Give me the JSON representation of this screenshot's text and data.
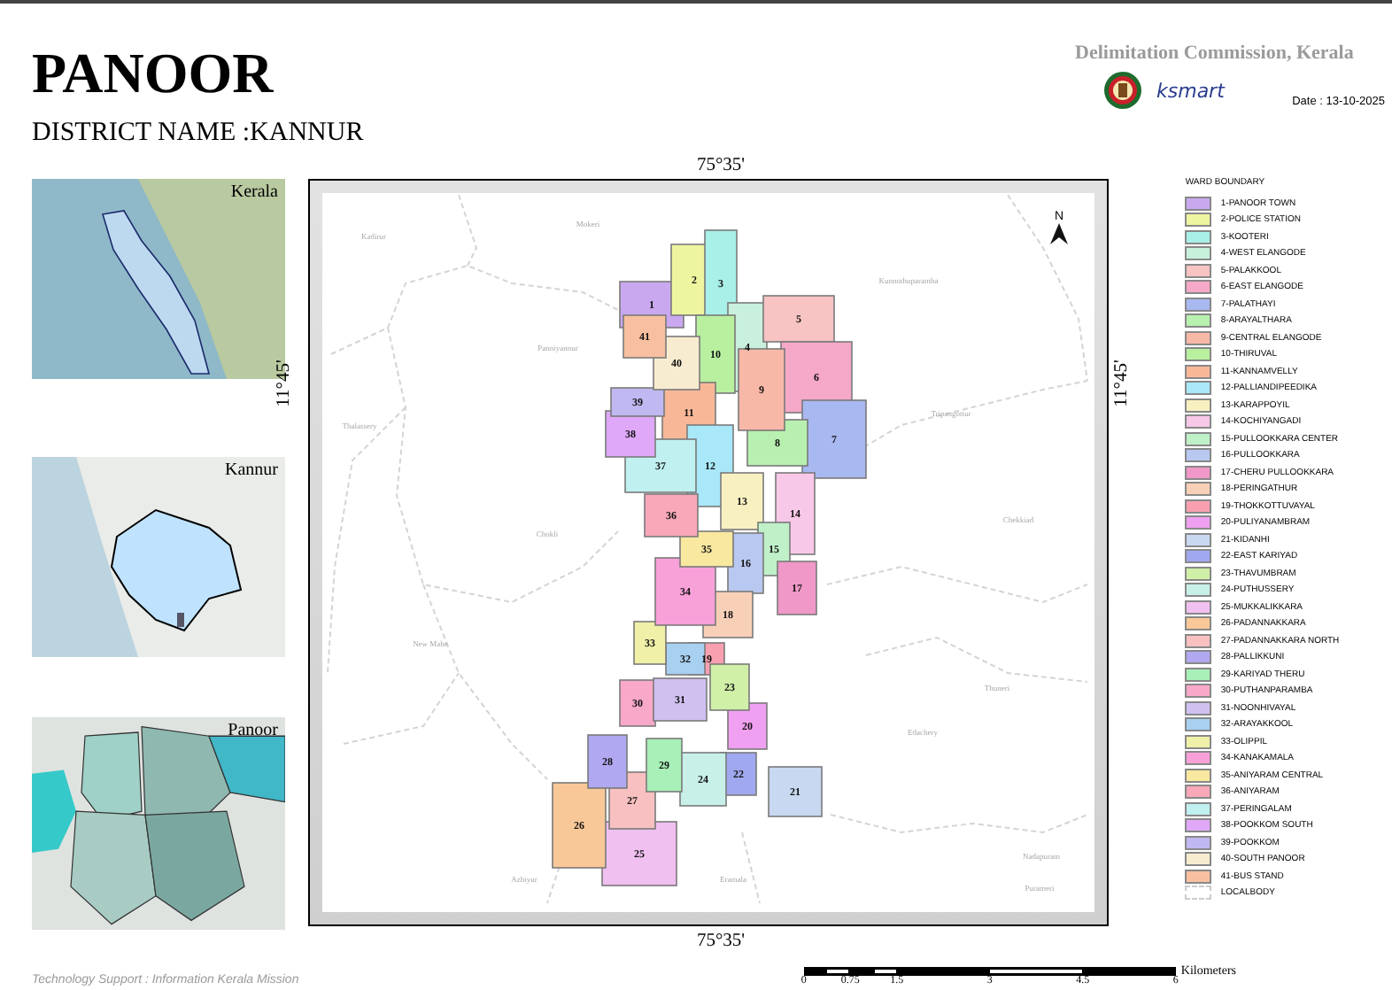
{
  "header": {
    "title": "PANOOR",
    "district": "DISTRICT NAME :KANNUR",
    "organisation": "Delimitation Commission, Kerala",
    "logo_text": "ksmart",
    "date": "Date : 13-10-2025"
  },
  "insets": [
    {
      "label": "Kerala",
      "kind": "state"
    },
    {
      "label": "Kannur",
      "kind": "district"
    },
    {
      "label": "Panoor",
      "kind": "local"
    }
  ],
  "map": {
    "top_coordinate": "75°35'",
    "bottom_coordinate": "75°35'",
    "left_coordinate": "11°45'",
    "right_coordinate": "11°45'",
    "north_label": "N",
    "places": [
      {
        "name": "Kadirur"
      },
      {
        "name": "Mokeri"
      },
      {
        "name": "Panniyannur"
      },
      {
        "name": "Kunnothuparamba"
      },
      {
        "name": "Thalassery"
      },
      {
        "name": "Tripangottur"
      },
      {
        "name": "Chokli"
      },
      {
        "name": "New Mahe"
      },
      {
        "name": "Chekkiad"
      },
      {
        "name": "Thuneri"
      },
      {
        "name": "Edachery"
      },
      {
        "name": "Azhiyur"
      },
      {
        "name": "Eramala"
      },
      {
        "name": "Nadapuram"
      },
      {
        "name": "Purameri"
      }
    ],
    "wards": [
      {
        "number": "1"
      },
      {
        "number": "2"
      },
      {
        "number": "3"
      },
      {
        "number": "4"
      },
      {
        "number": "5"
      },
      {
        "number": "6"
      },
      {
        "number": "7"
      },
      {
        "number": "8"
      },
      {
        "number": "9"
      },
      {
        "number": "10"
      },
      {
        "number": "11"
      },
      {
        "number": "12"
      },
      {
        "number": "13"
      },
      {
        "number": "14"
      },
      {
        "number": "15"
      },
      {
        "number": "16"
      },
      {
        "number": "17"
      },
      {
        "number": "18"
      },
      {
        "number": "19"
      },
      {
        "number": "20"
      },
      {
        "number": "21"
      },
      {
        "number": "22"
      },
      {
        "number": "23"
      },
      {
        "number": "24"
      },
      {
        "number": "25"
      },
      {
        "number": "26"
      },
      {
        "number": "27"
      },
      {
        "number": "28"
      },
      {
        "number": "29"
      },
      {
        "number": "30"
      },
      {
        "number": "31"
      },
      {
        "number": "32"
      },
      {
        "number": "33"
      },
      {
        "number": "34"
      },
      {
        "number": "35"
      },
      {
        "number": "36"
      },
      {
        "number": "37"
      },
      {
        "number": "38"
      },
      {
        "number": "39"
      },
      {
        "number": "40"
      },
      {
        "number": "41"
      }
    ]
  },
  "legend": {
    "title": "WARD BOUNDARY",
    "items": [
      {
        "label": "1-PANOOR TOWN",
        "kind": "fill",
        "color": "#c9a8f0"
      },
      {
        "label": "2-POLICE STATION",
        "kind": "fill",
        "color": "#eef5a0"
      },
      {
        "label": "3-KOOTERI",
        "kind": "fill",
        "color": "#a8f0e8"
      },
      {
        "label": "4-WEST ELANGODE",
        "kind": "fill",
        "color": "#c8f0dc"
      },
      {
        "label": "5-PALAKKOOL",
        "kind": "fill",
        "color": "#f7c3c3"
      },
      {
        "label": "6-EAST ELANGODE",
        "kind": "fill",
        "color": "#f5a8c8"
      },
      {
        "label": "7-PALATHAYI",
        "kind": "fill",
        "color": "#a8b8f0"
      },
      {
        "label": "8-ARAYALTHARA",
        "kind": "fill",
        "color": "#b8f0b0"
      },
      {
        "label": "9-CENTRAL ELANGODE",
        "kind": "fill",
        "color": "#f8b8a8"
      },
      {
        "label": "10-THIRUVAL",
        "kind": "fill",
        "color": "#b8f0a0"
      },
      {
        "label": "11-KANNAMVELLY",
        "kind": "fill",
        "color": "#f8b898"
      },
      {
        "label": "12-PALLIANDIPEEDIKA",
        "kind": "fill",
        "color": "#a8e8f8"
      },
      {
        "label": "13-KARAPPOYIL",
        "kind": "fill",
        "color": "#f8f0c0"
      },
      {
        "label": "14-KOCHIYANGADI",
        "kind": "fill",
        "color": "#f8c8e8"
      },
      {
        "label": "15-PULLOOKKARA CENTER",
        "kind": "fill",
        "color": "#c0f0c8"
      },
      {
        "label": "16-PULLOOKKARA",
        "kind": "fill",
        "color": "#b8c8f0"
      },
      {
        "label": "17-CHERU PULLOOKKARA",
        "kind": "fill",
        "color": "#f098c8"
      },
      {
        "label": "18-PERINGATHUR",
        "kind": "fill",
        "color": "#f8d0b8"
      },
      {
        "label": "19-THOKKOTTUVAYAL",
        "kind": "fill",
        "color": "#f8a0b0"
      },
      {
        "label": "20-PULIYANAMBRAM",
        "kind": "fill",
        "color": "#f0a0f0"
      },
      {
        "label": "21-KIDANHI",
        "kind": "fill",
        "color": "#c8d8f0"
      },
      {
        "label": "22-EAST KARIYAD",
        "kind": "fill",
        "color": "#a0a8f0"
      },
      {
        "label": "23-THAVUMBRAM",
        "kind": "fill",
        "color": "#d0f0a8"
      },
      {
        "label": "24-PUTHUSSERY",
        "kind": "fill",
        "color": "#c8f0e8"
      },
      {
        "label": "25-MUKKALIKKARA",
        "kind": "fill",
        "color": "#f0c0f0"
      },
      {
        "label": "26-PADANNAKKARA",
        "kind": "fill",
        "color": "#f8c898"
      },
      {
        "label": "27-PADANNAKKARA NORTH",
        "kind": "fill",
        "color": "#f8c0c0"
      },
      {
        "label": "28-PALLIKKUNI",
        "kind": "fill",
        "color": "#b0a8f0"
      },
      {
        "label": "29-KARIYAD THERU",
        "kind": "fill",
        "color": "#a8f0b8"
      },
      {
        "label": "30-PUTHANPARAMBA",
        "kind": "fill",
        "color": "#f8a8c8"
      },
      {
        "label": "31-NOONHIVAYAL",
        "kind": "fill",
        "color": "#d0c0f0"
      },
      {
        "label": "32-ARAYAKKOOL",
        "kind": "fill",
        "color": "#a8d0f0"
      },
      {
        "label": "33-OLIPPIL",
        "kind": "fill",
        "color": "#f0f0a8"
      },
      {
        "label": "34-KANAKAMALA",
        "kind": "fill",
        "color": "#f8a0d8"
      },
      {
        "label": "35-ANIYARAM CENTRAL",
        "kind": "fill",
        "color": "#f8e8a0"
      },
      {
        "label": "36-ANIYARAM",
        "kind": "fill",
        "color": "#f8a8b8"
      },
      {
        "label": "37-PERINGALAM",
        "kind": "fill",
        "color": "#c0f0f0"
      },
      {
        "label": "38-POOKKOM SOUTH",
        "kind": "fill",
        "color": "#e0a8f8"
      },
      {
        "label": "39-POOKKOM",
        "kind": "fill",
        "color": "#c0b8f0"
      },
      {
        "label": "40-SOUTH PANOOR",
        "kind": "fill",
        "color": "#f8ecd0"
      },
      {
        "label": "41-BUS STAND",
        "kind": "fill",
        "color": "#f8c0a0"
      },
      {
        "label": "LOCALBODY",
        "kind": "dashed"
      }
    ]
  },
  "footer": {
    "credit": "Technology Support : Information Kerala Mission",
    "scale_ticks": [
      "0",
      "0.75",
      "1.5",
      "3",
      "4.5",
      "6"
    ],
    "scale_unit": "Kilometers"
  }
}
